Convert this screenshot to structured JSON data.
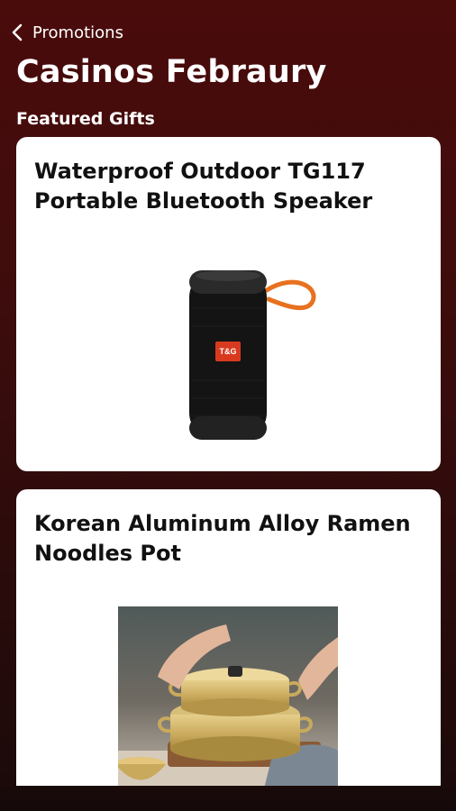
{
  "nav": {
    "back_label": "Promotions",
    "back_icon": "chevron-left-icon"
  },
  "page": {
    "title": "Casinos Febraury",
    "section_title": "Featured Gifts"
  },
  "gifts": [
    {
      "title": "Waterproof Outdoor TG117 Portable Bluetooth Speaker",
      "badge": "T&G"
    },
    {
      "title": "Korean Aluminum Alloy Ramen Noodles Pot"
    }
  ],
  "colors": {
    "background_top": "#4a0b0b",
    "background_bottom": "#1a0a0a",
    "card_bg": "#ffffff",
    "strap_orange": "#e8711f",
    "badge_red": "#d93a1f"
  }
}
